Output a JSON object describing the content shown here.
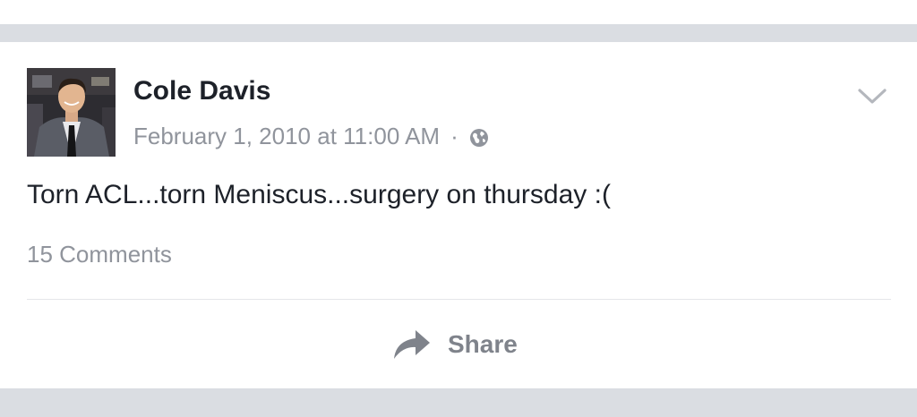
{
  "post": {
    "author": "Cole Davis",
    "timestamp": "February 1, 2010 at 11:00 AM",
    "separator": "·",
    "privacy_icon": "globe-icon",
    "menu_icon": "chevron-down-icon",
    "text": "Torn ACL...torn Meniscus...surgery on thursday :(",
    "comments_count": "15 Comments",
    "actions": {
      "share_label": "Share",
      "share_icon": "share-arrow-icon"
    }
  },
  "colors": {
    "feed_background": "#dadde2",
    "card_background": "#ffffff",
    "primary_text": "#1d2129",
    "secondary_text": "#90949c",
    "divider": "#e5e6e9",
    "action_text": "#7f838b"
  }
}
